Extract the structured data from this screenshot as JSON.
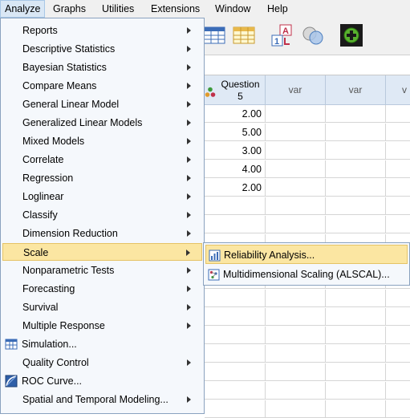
{
  "menubar": {
    "items": [
      {
        "label": "Analyze",
        "active": true
      },
      {
        "label": "Graphs"
      },
      {
        "label": "Utilities"
      },
      {
        "label": "Extensions"
      },
      {
        "label": "Window"
      },
      {
        "label": "Help"
      }
    ]
  },
  "analyze_menu": {
    "items": [
      {
        "label": "Reports",
        "submenu": true
      },
      {
        "label": "Descriptive Statistics",
        "submenu": true
      },
      {
        "label": "Bayesian Statistics",
        "submenu": true
      },
      {
        "label": "Compare Means",
        "submenu": true
      },
      {
        "label": "General Linear Model",
        "submenu": true
      },
      {
        "label": "Generalized Linear Models",
        "submenu": true
      },
      {
        "label": "Mixed Models",
        "submenu": true
      },
      {
        "label": "Correlate",
        "submenu": true
      },
      {
        "label": "Regression",
        "submenu": true
      },
      {
        "label": "Loglinear",
        "submenu": true
      },
      {
        "label": "Classify",
        "submenu": true
      },
      {
        "label": "Dimension Reduction",
        "submenu": true
      },
      {
        "label": "Scale",
        "submenu": true,
        "selected": true
      },
      {
        "label": "Nonparametric Tests",
        "submenu": true
      },
      {
        "label": "Forecasting",
        "submenu": true
      },
      {
        "label": "Survival",
        "submenu": true
      },
      {
        "label": "Multiple Response",
        "submenu": true
      },
      {
        "label": "Simulation...",
        "icon": "simulation-icon"
      },
      {
        "label": "Quality Control",
        "submenu": true
      },
      {
        "label": "ROC Curve...",
        "icon": "roc-curve-icon"
      },
      {
        "label": "Spatial and Temporal Modeling...",
        "submenu": true
      }
    ]
  },
  "scale_submenu": {
    "items": [
      {
        "label": "Reliability Analysis...",
        "icon": "reliability-icon",
        "selected": true
      },
      {
        "label": "Multidimensional Scaling (ALSCAL)...",
        "icon": "alscal-icon"
      }
    ]
  },
  "grid": {
    "columns": [
      {
        "label": "Question\n5",
        "line1": "Question",
        "line2": "5"
      },
      {
        "label": "var"
      },
      {
        "label": "var"
      },
      {
        "label": "v"
      }
    ],
    "question5_values": [
      "2.00",
      "5.00",
      "3.00",
      "4.00",
      "2.00"
    ]
  },
  "toolbar": {
    "icons": [
      "data-grid-icon",
      "variable-grid-icon",
      "value-labels-icon",
      "sets-icon",
      "add-extension-icon"
    ]
  }
}
